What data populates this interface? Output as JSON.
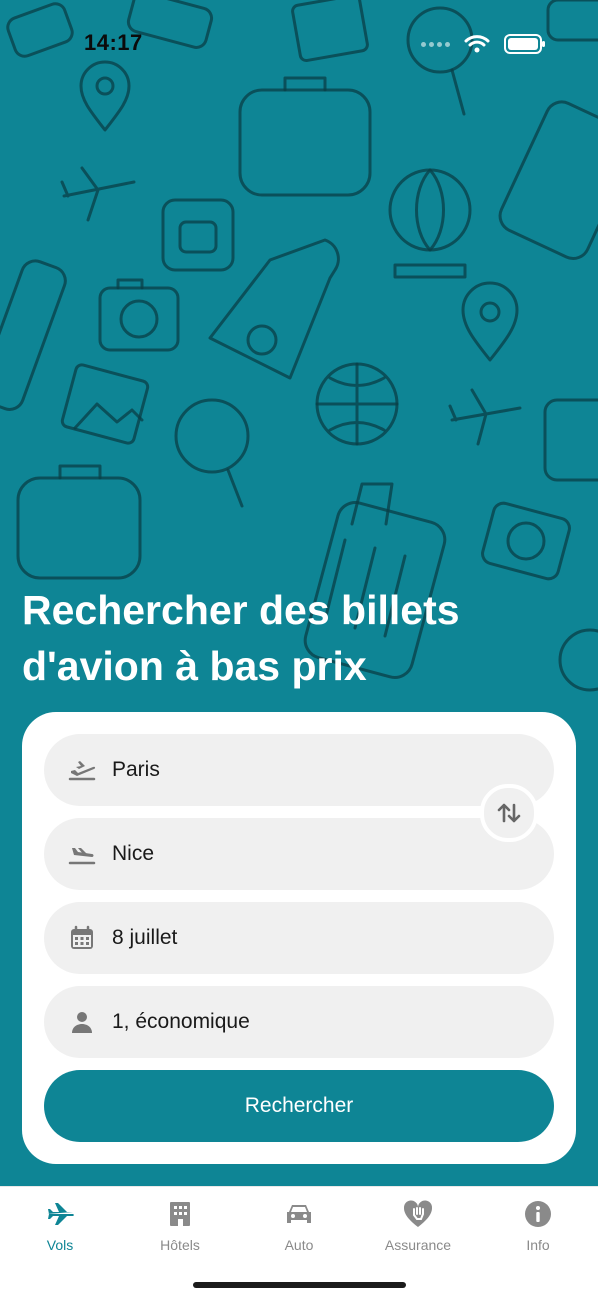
{
  "status_bar": {
    "time": "14:17"
  },
  "headline": "Rechercher des billets d'avion à bas prix",
  "form": {
    "origin": {
      "value": "Paris",
      "icon": "takeoff-icon"
    },
    "destination": {
      "value": "Nice",
      "icon": "landing-icon"
    },
    "date": {
      "value": "8 juillet",
      "icon": "calendar-icon"
    },
    "passengers": {
      "value": "1, économique",
      "icon": "person-icon"
    },
    "swap_icon": "swap-arrows-icon",
    "search_label": "Rechercher"
  },
  "tabs": [
    {
      "label": "Vols",
      "icon": "airplane-icon",
      "active": true
    },
    {
      "label": "Hôtels",
      "icon": "building-icon",
      "active": false
    },
    {
      "label": "Auto",
      "icon": "car-icon",
      "active": false
    },
    {
      "label": "Assurance",
      "icon": "heart-hand-icon",
      "active": false
    },
    {
      "label": "Info",
      "icon": "info-icon",
      "active": false
    }
  ],
  "colors": {
    "brand": "#0e8595",
    "pattern": "#0a3f47",
    "field_bg": "#f0f0f0",
    "inactive_tab": "#8a8a8a"
  }
}
